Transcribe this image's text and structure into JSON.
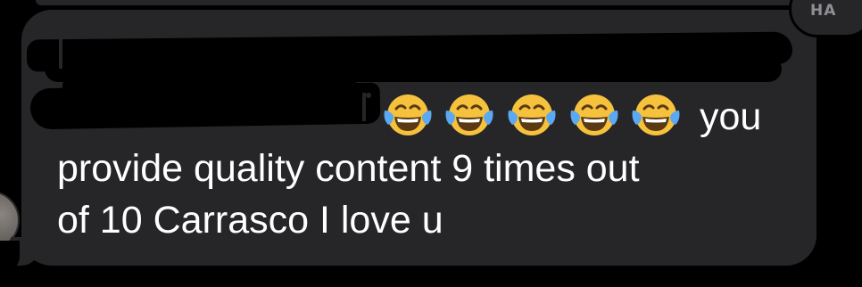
{
  "tapback": {
    "label": "HA"
  },
  "message": {
    "line1_tail": "you",
    "line2": "provide quality content 9 times out",
    "line3": "of 10 Carrasco I love u",
    "emoji_name": "face-with-tears-of-joy",
    "emoji_count": 5
  },
  "colors": {
    "background": "#000000",
    "bubble": "#262629",
    "text": "#ffffff",
    "tapback_text": "#8e8e93"
  }
}
